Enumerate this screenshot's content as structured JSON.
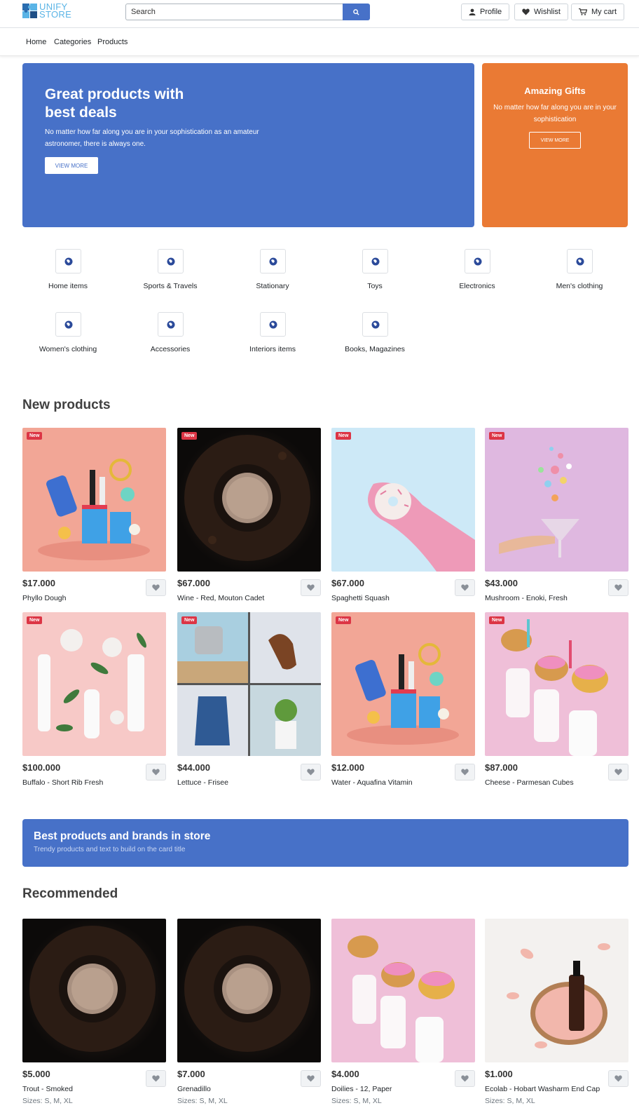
{
  "brand": {
    "name_line1": "UNIFY",
    "name_line2": "STORE",
    "color": "#5ab4e6"
  },
  "search": {
    "placeholder": "Search",
    "icon": "search-icon"
  },
  "header_actions": [
    {
      "label": "Profile",
      "icon": "user-icon"
    },
    {
      "label": "Wishlist",
      "icon": "heart-icon"
    },
    {
      "label": "My cart",
      "icon": "cart-icon"
    }
  ],
  "nav": [
    "Home",
    "Categories",
    "Products"
  ],
  "hero": {
    "title": "Great products with best deals",
    "text": "No matter how far along you are in your sophistication as an amateur astronomer, there is always one.",
    "button": "VIEW MORE",
    "color": "#4771c8"
  },
  "gift": {
    "title": "Amazing Gifts",
    "text": "No matter how far along you are in your sophistication",
    "button": "VIEW MORE",
    "color": "#ea7a34"
  },
  "categories": [
    "Home items",
    "Sports & Travels",
    "Stationary",
    "Toys",
    "Electronics",
    "Men's clothing",
    "Women's clothing",
    "Accessories",
    "Interiors items",
    "Books, Magazines"
  ],
  "new_products": {
    "title": "New products",
    "badge": "New",
    "items": [
      {
        "price": "$17.000",
        "name": "Phyllo Dough"
      },
      {
        "price": "$67.000",
        "name": "Wine - Red, Mouton Cadet"
      },
      {
        "price": "$67.000",
        "name": "Spaghetti Squash"
      },
      {
        "price": "$43.000",
        "name": "Mushroom - Enoki, Fresh"
      },
      {
        "price": "$100.000",
        "name": "Buffalo - Short Rib Fresh"
      },
      {
        "price": "$44.000",
        "name": "Lettuce - Frisee"
      },
      {
        "price": "$12.000",
        "name": "Water - Aquafina Vitamin"
      },
      {
        "price": "$87.000",
        "name": "Cheese - Parmesan Cubes"
      }
    ]
  },
  "brand_banner": {
    "title": "Best products and brands in store",
    "subtitle": "Trendy products and text to build on the card title"
  },
  "recommended": {
    "title": "Recommended",
    "items": [
      {
        "price": "$5.000",
        "name": "Trout - Smoked",
        "sizes": "Sizes: S, M, XL"
      },
      {
        "price": "$7.000",
        "name": "Grenadillo",
        "sizes": "Sizes: S, M, XL"
      },
      {
        "price": "$4.000",
        "name": "Doilies - 12, Paper",
        "sizes": "Sizes: S, M, XL"
      },
      {
        "price": "$1.000",
        "name": "Ecolab - Hobart Washarm End Cap",
        "sizes": "Sizes: S, M, XL"
      }
    ]
  }
}
